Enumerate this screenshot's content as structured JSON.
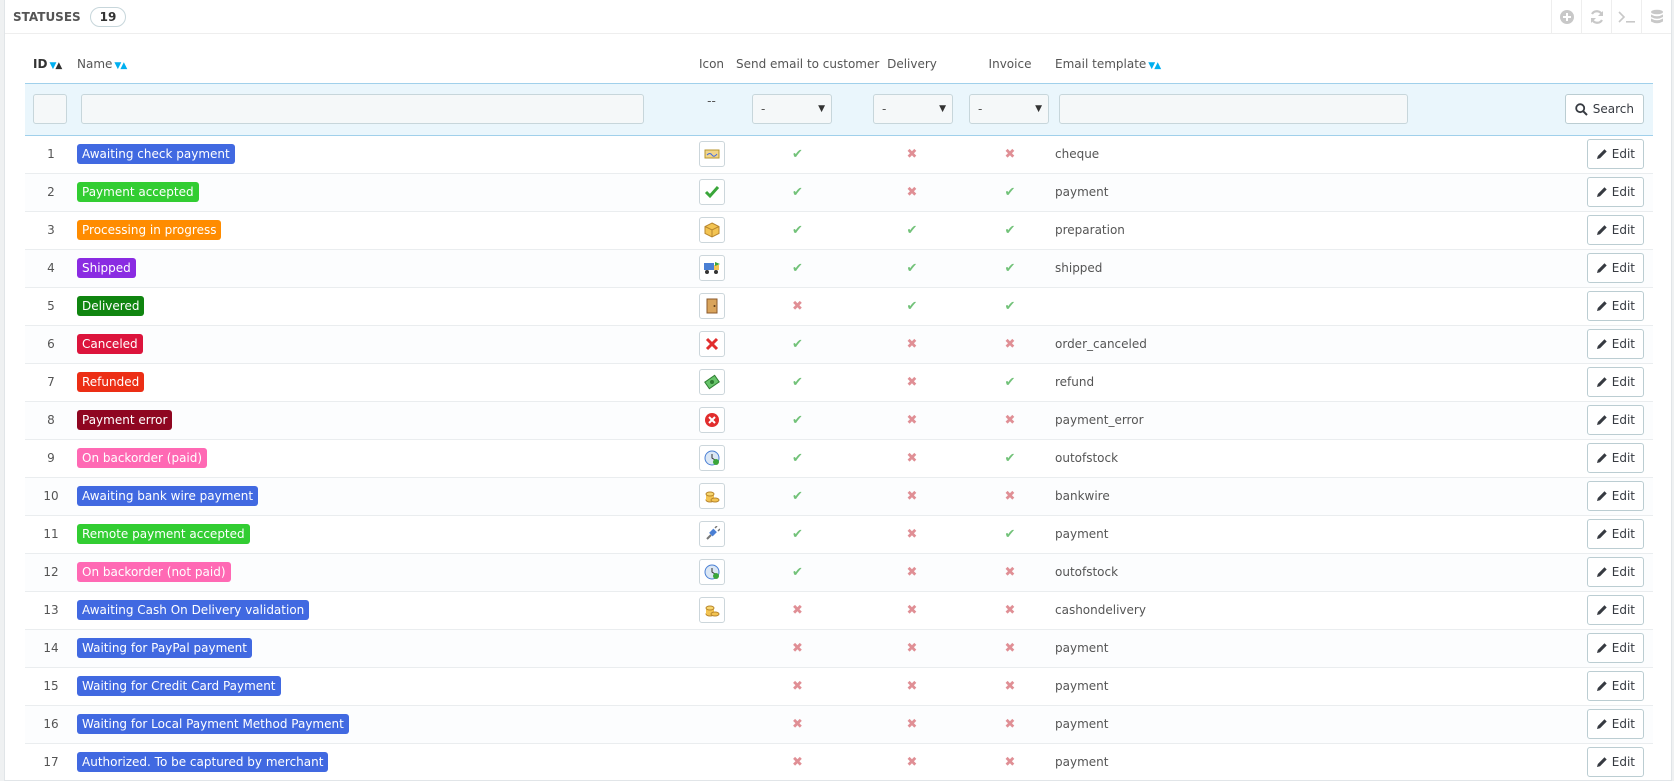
{
  "panel": {
    "title": "STATUSES",
    "count": "19"
  },
  "toolbar": {
    "items": [
      "add-icon",
      "refresh-icon",
      "terminal-icon",
      "database-icon"
    ]
  },
  "columns": {
    "id": "ID",
    "name": "Name",
    "icon": "Icon",
    "send_email": "Send email to customer",
    "delivery": "Delivery",
    "invoice": "Invoice",
    "email_template": "Email template"
  },
  "filters": {
    "icon_placeholder": "--",
    "send_email_value": "-",
    "delivery_value": "-",
    "invoice_value": "-",
    "search_label": "Search"
  },
  "edit_label": "Edit",
  "rows": [
    {
      "id": "1",
      "name": "Awaiting check payment",
      "color": "#4169e1",
      "icon": "cheque-icon",
      "send_email": true,
      "delivery": false,
      "invoice": false,
      "template": "cheque"
    },
    {
      "id": "2",
      "name": "Payment accepted",
      "color": "#32cd32",
      "icon": "check-icon",
      "send_email": true,
      "delivery": false,
      "invoice": true,
      "template": "payment"
    },
    {
      "id": "3",
      "name": "Processing in progress",
      "color": "#ff8c00",
      "icon": "package-icon",
      "send_email": true,
      "delivery": true,
      "invoice": true,
      "template": "preparation"
    },
    {
      "id": "4",
      "name": "Shipped",
      "color": "#8a2be2",
      "icon": "truck-icon",
      "send_email": true,
      "delivery": true,
      "invoice": true,
      "template": "shipped"
    },
    {
      "id": "5",
      "name": "Delivered",
      "color": "#108510",
      "icon": "door-icon",
      "send_email": false,
      "delivery": true,
      "invoice": true,
      "template": ""
    },
    {
      "id": "6",
      "name": "Canceled",
      "color": "#dc143c",
      "icon": "cross-icon",
      "send_email": true,
      "delivery": false,
      "invoice": false,
      "template": "order_canceled"
    },
    {
      "id": "7",
      "name": "Refunded",
      "color": "#ec2e15",
      "icon": "money-icon",
      "send_email": true,
      "delivery": false,
      "invoice": true,
      "template": "refund"
    },
    {
      "id": "8",
      "name": "Payment error",
      "color": "#8f0621",
      "icon": "error-icon",
      "send_email": true,
      "delivery": false,
      "invoice": false,
      "template": "payment_error"
    },
    {
      "id": "9",
      "name": "On backorder (paid)",
      "color": "#ff69b4",
      "icon": "clock-icon",
      "send_email": true,
      "delivery": false,
      "invoice": true,
      "template": "outofstock"
    },
    {
      "id": "10",
      "name": "Awaiting bank wire payment",
      "color": "#4169e1",
      "icon": "coins-icon",
      "send_email": true,
      "delivery": false,
      "invoice": false,
      "template": "bankwire"
    },
    {
      "id": "11",
      "name": "Remote payment accepted",
      "color": "#32cd32",
      "icon": "plug-icon",
      "send_email": true,
      "delivery": false,
      "invoice": true,
      "template": "payment"
    },
    {
      "id": "12",
      "name": "On backorder (not paid)",
      "color": "#ff69b4",
      "icon": "clock-icon",
      "send_email": true,
      "delivery": false,
      "invoice": false,
      "template": "outofstock"
    },
    {
      "id": "13",
      "name": "Awaiting Cash On Delivery validation",
      "color": "#4169e1",
      "icon": "coins-icon",
      "send_email": false,
      "delivery": false,
      "invoice": false,
      "template": "cashondelivery"
    },
    {
      "id": "14",
      "name": "Waiting for PayPal payment",
      "color": "#4169e1",
      "icon": "",
      "send_email": false,
      "delivery": false,
      "invoice": false,
      "template": "payment"
    },
    {
      "id": "15",
      "name": "Waiting for Credit Card Payment",
      "color": "#4169e1",
      "icon": "",
      "send_email": false,
      "delivery": false,
      "invoice": false,
      "template": "payment"
    },
    {
      "id": "16",
      "name": "Waiting for Local Payment Method Payment",
      "color": "#4169e1",
      "icon": "",
      "send_email": false,
      "delivery": false,
      "invoice": false,
      "template": "payment"
    },
    {
      "id": "17",
      "name": "Authorized. To be captured by merchant",
      "color": "#4169e1",
      "icon": "",
      "send_email": false,
      "delivery": false,
      "invoice": false,
      "template": "payment"
    }
  ]
}
